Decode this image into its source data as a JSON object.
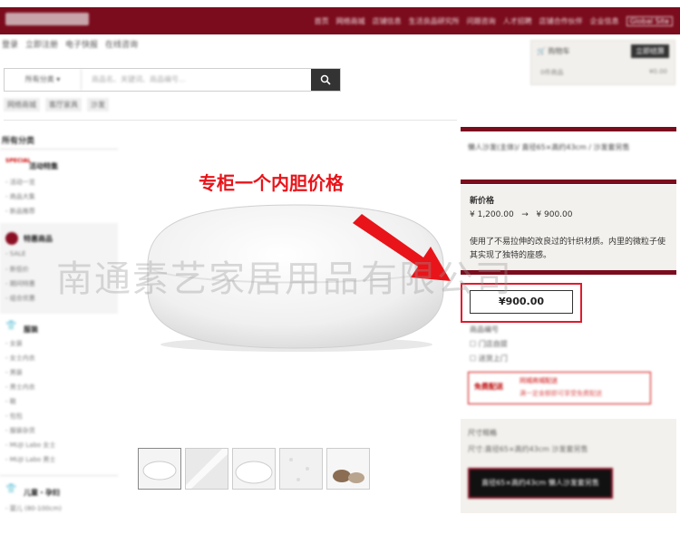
{
  "header": {
    "logo_text": "MUJI 無印良品",
    "nav": [
      "首页",
      "网络商城",
      "店铺信息",
      "生活良品研究所",
      "问题咨询",
      "人才招聘",
      "店铺合作伙伴",
      "企业信息",
      "Global Site"
    ]
  },
  "subnav": [
    "登录",
    "立即注册",
    "电子快报",
    "在线咨询"
  ],
  "cart": {
    "label": "购物车",
    "button": "立即结算",
    "count": "0件商品",
    "amount": "¥0.00"
  },
  "search": {
    "category": "所有分类 ▾",
    "placeholder": "商品名、关键词、商品编号...",
    "button_icon": "search-icon"
  },
  "breadcrumbs": [
    "网络商城",
    "客厅家具",
    "沙发"
  ],
  "sidebar": {
    "title": "所有分类",
    "special": {
      "badge": "SPECIAL",
      "label": "活动特集",
      "items": [
        "活动一览",
        "商品大集",
        "新品推荐"
      ]
    },
    "sale": {
      "label": "特惠商品",
      "items": [
        "SALE",
        "新低价",
        "期间特惠",
        "组合优惠"
      ]
    },
    "clothing": {
      "label": "服装",
      "items": [
        "女装",
        "女士内衣",
        "男装",
        "男士内衣",
        "鞋",
        "包包",
        "服装杂货",
        "MUJI Labo 女士",
        "MUJI Labo 男士"
      ]
    },
    "kids": {
      "label": "儿童・孕妇",
      "items": [
        "婴儿 (80-100cm)"
      ]
    }
  },
  "annotation": "专柜一个内胆价格",
  "watermark": "南通素艺家居用品有限公司",
  "product": {
    "title": "懒人沙发(主体)/ 直径65×高约43cm / 沙发套另售",
    "price_label": "新价格",
    "old_price": "¥ 1,200.00",
    "arrow": "→",
    "new_price": "¥ 900.00",
    "description": "使用了不易拉伸的改良过的针织材质。内里的微粒子使其实现了独特的座感。",
    "highlight_price": "¥900.00",
    "stock_label": "商品编号",
    "ship1": "门店自提",
    "ship2": "送货上门",
    "coupon_left": "免费配送",
    "coupon_r1": "同城商城配送",
    "coupon_r2": "满一定金额即可享受免费配送",
    "size_label": "尺寸规格",
    "size_value": "尺寸:直径65×高约43cm 沙发套另售",
    "cart_button": "直径65×高约43cm 懒人沙发套另售"
  },
  "colors": {
    "brand": "#7b0c1d",
    "annotation": "#e8141a",
    "price_box": "#e01b2d"
  }
}
